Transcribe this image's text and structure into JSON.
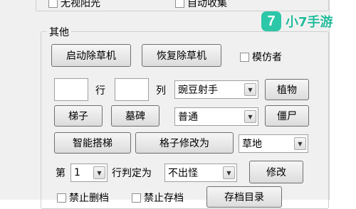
{
  "top_row": {
    "no_sunshine": "无视阳光",
    "auto_collect": "自动收集"
  },
  "group": {
    "title": "其他",
    "start_mower": "启动除草机",
    "restore_mower": "恢复除草机",
    "imitater": "模仿者",
    "row_label": "行",
    "col_label": "列",
    "plant_select": "豌豆射手",
    "plant_button": "植物",
    "ladder_button": "梯子",
    "tombstone_button": "墓碑",
    "zombie_select": "普通",
    "zombie_button": "僵尸",
    "smart_ladder_button": "智能搭梯",
    "grid_modify_button": "格子修改为",
    "grid_select": "草地",
    "row_prefix": "第",
    "row_number": "1",
    "row_set_label": "行判定为",
    "row_type_select": "不出怪",
    "modify_button": "修改",
    "no_delete_save": "禁止删档",
    "no_save": "禁止存档",
    "save_dir_button": "存档目录"
  },
  "watermark": {
    "badge": "7",
    "text": "小7手游"
  },
  "colors": {
    "window_bg": "#f0f0f0",
    "logo_accent": "#2cc7a8"
  }
}
